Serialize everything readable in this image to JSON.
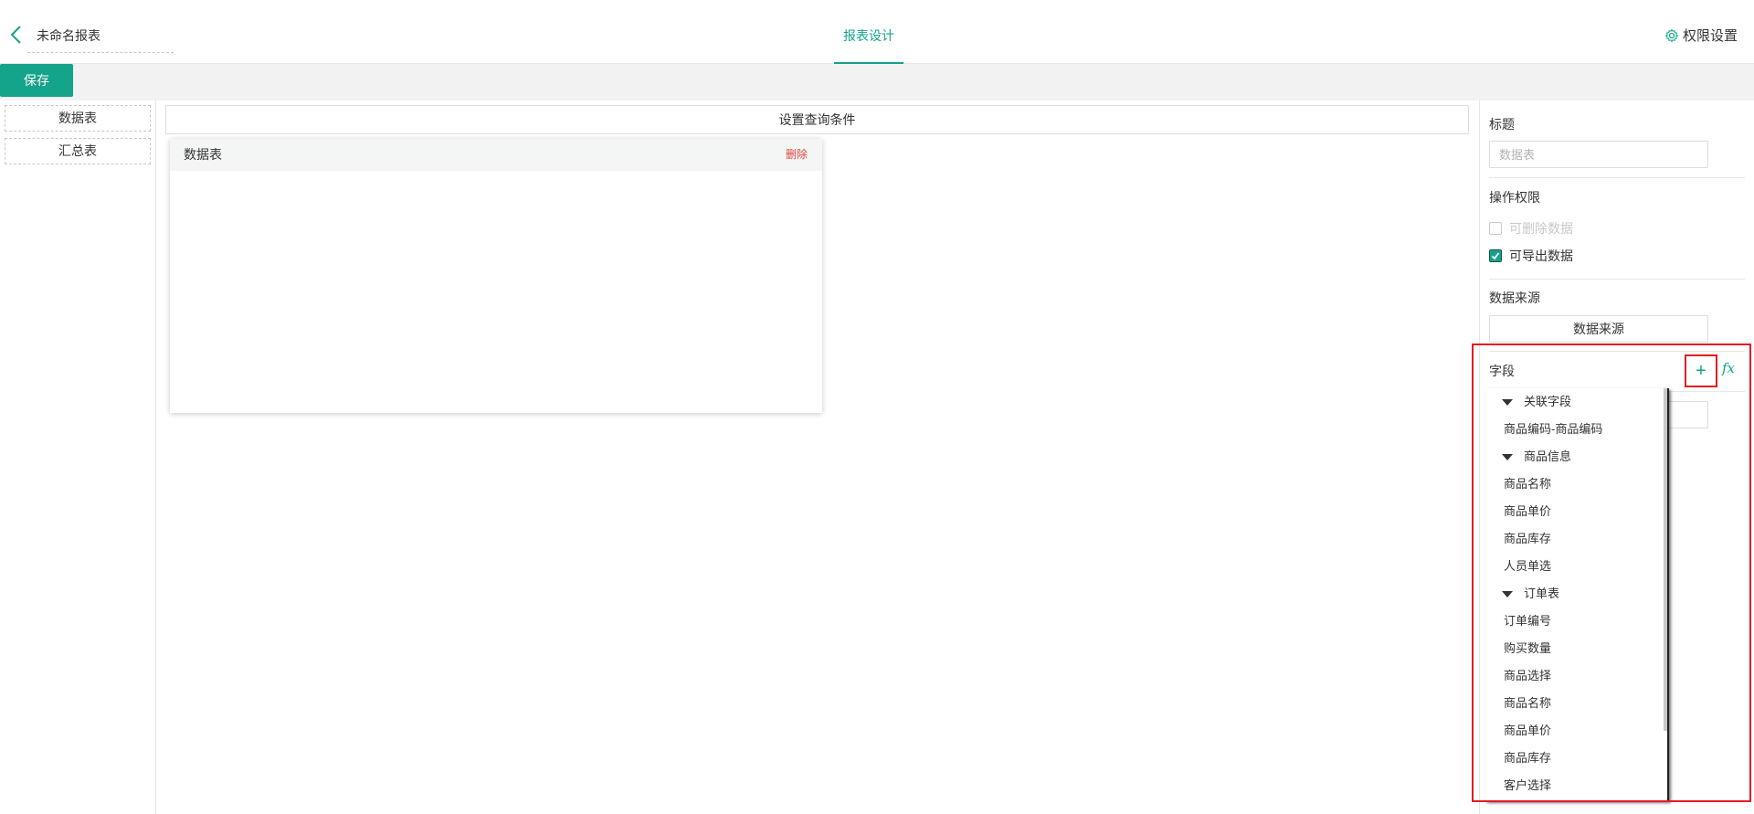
{
  "header": {
    "report_name": "未命名报表",
    "tab_design": "报表设计",
    "perm_settings": "权限设置"
  },
  "toolbar": {
    "save_label": "保存"
  },
  "left_panel": {
    "items": [
      {
        "label": "数据表"
      },
      {
        "label": "汇总表"
      }
    ]
  },
  "center": {
    "query_button": "设置查询条件",
    "card": {
      "title": "数据表",
      "delete_label": "删除"
    }
  },
  "right_panel": {
    "title_label": "标题",
    "title_placeholder": "数据表",
    "ops_label": "操作权限",
    "can_delete": "可删除数据",
    "can_export": "可导出数据",
    "source_label": "数据来源",
    "source_button": "数据来源",
    "field_label": "字段",
    "plus_symbol": "+",
    "fx_symbol": "fx"
  },
  "dropdown": {
    "groups": [
      {
        "name": "关联字段",
        "items": [
          "商品编码-商品编码"
        ]
      },
      {
        "name": "商品信息",
        "items": [
          "商品名称",
          "商品单价",
          "商品库存",
          "人员单选"
        ]
      },
      {
        "name": "订单表",
        "items": [
          "订单编号",
          "购买数量",
          "商品选择",
          "商品名称",
          "商品单价",
          "商品库存",
          "客户选择"
        ]
      }
    ]
  },
  "colors": {
    "accent": "#14a38b",
    "danger": "#e0473c",
    "highlight": "#e31b23"
  }
}
